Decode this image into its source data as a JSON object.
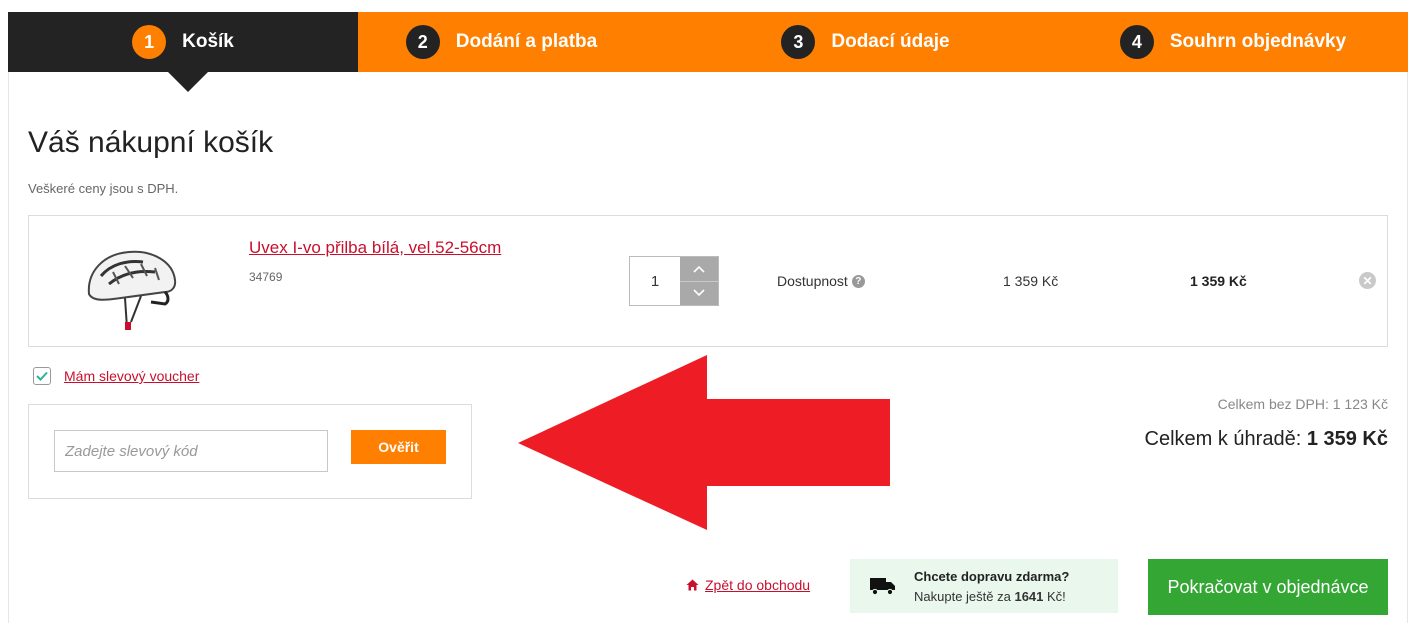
{
  "steps": [
    {
      "number": "1",
      "label": "Košík"
    },
    {
      "number": "2",
      "label": "Dodání a platba"
    },
    {
      "number": "3",
      "label": "Dodací údaje"
    },
    {
      "number": "4",
      "label": "Souhrn objednávky"
    }
  ],
  "cart": {
    "title": "Váš nákupní košík",
    "vat_note": "Veškeré ceny jsou s DPH.",
    "item": {
      "name": "Uvex I-vo přilba bílá, vel.52-56cm",
      "code": "34769",
      "quantity": "1",
      "availability": "Dostupnost",
      "unit_price": "1 359 Kč",
      "total_price": "1 359 Kč"
    }
  },
  "voucher": {
    "toggle_label": "Mám slevový voucher",
    "input_placeholder": "Zadejte slevový kód",
    "verify_label": "Ověřit"
  },
  "summary": {
    "without_vat": "Celkem bez DPH: 1 123 Kč",
    "total_label": "Celkem k úhradě:",
    "total_value": "1 359 Kč"
  },
  "footer": {
    "back_link": "Zpět do obchodu",
    "shipping_question": "Chcete dopravu zdarma?",
    "shipping_prefix": "Nakupte ještě za",
    "shipping_amount": "1641",
    "shipping_suffix": "Kč!",
    "continue_label": "Pokračovat v objednávce"
  },
  "colors": {
    "accent_orange": "#ff7f00",
    "dark": "#232323",
    "link_red": "#c8102e",
    "success_green": "#34a634",
    "arrow_red": "#ee1c25"
  },
  "icons": [
    "question-icon",
    "remove-icon",
    "chevron-up-icon",
    "chevron-down-icon",
    "check-icon",
    "home-icon",
    "truck-icon",
    "arrow-left-icon"
  ]
}
